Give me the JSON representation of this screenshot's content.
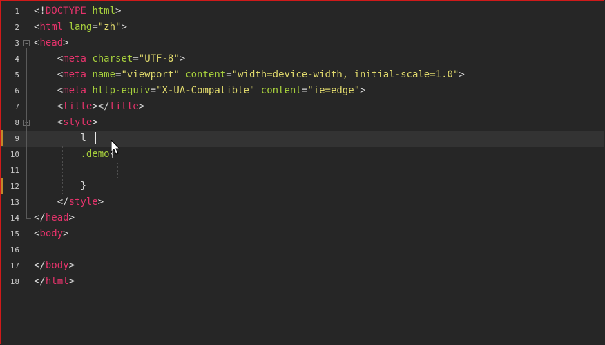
{
  "editor": {
    "colors": {
      "background": "#262626",
      "current_line": "#333333",
      "border": "#d01a1a",
      "tag": "#e5336b",
      "attr": "#a6cf3c",
      "string": "#dfd86c",
      "punct": "#d8d8d8",
      "line_number": "#c9c9c9"
    },
    "current_line_number": "9",
    "lines": [
      {
        "num": "1",
        "indent": "",
        "tokens": [
          [
            "p",
            "<!"
          ],
          [
            "t",
            "DOCTYPE"
          ],
          [
            "p",
            " "
          ],
          [
            "a",
            "html"
          ],
          [
            "p",
            ">"
          ]
        ]
      },
      {
        "num": "2",
        "indent": "",
        "tokens": [
          [
            "p",
            "<"
          ],
          [
            "t",
            "html"
          ],
          [
            "p",
            " "
          ],
          [
            "a",
            "lang"
          ],
          [
            "p",
            "="
          ],
          [
            "s",
            "\"zh\""
          ],
          [
            "p",
            ">"
          ]
        ]
      },
      {
        "num": "3",
        "indent": "",
        "fold": "open",
        "tokens": [
          [
            "p",
            "<"
          ],
          [
            "t",
            "head"
          ],
          [
            "p",
            ">"
          ]
        ]
      },
      {
        "num": "4",
        "indent": "    ",
        "tokens": [
          [
            "p",
            "<"
          ],
          [
            "t",
            "meta"
          ],
          [
            "p",
            " "
          ],
          [
            "a",
            "charset"
          ],
          [
            "p",
            "="
          ],
          [
            "s",
            "\"UTF-8\""
          ],
          [
            "p",
            ">"
          ]
        ]
      },
      {
        "num": "5",
        "indent": "    ",
        "tokens": [
          [
            "p",
            "<"
          ],
          [
            "t",
            "meta"
          ],
          [
            "p",
            " "
          ],
          [
            "a",
            "name"
          ],
          [
            "p",
            "="
          ],
          [
            "s",
            "\"viewport\""
          ],
          [
            "p",
            " "
          ],
          [
            "a",
            "content"
          ],
          [
            "p",
            "="
          ],
          [
            "s",
            "\"width=device-width, initial-scale=1.0\""
          ],
          [
            "p",
            ">"
          ]
        ]
      },
      {
        "num": "6",
        "indent": "    ",
        "tokens": [
          [
            "p",
            "<"
          ],
          [
            "t",
            "meta"
          ],
          [
            "p",
            " "
          ],
          [
            "a",
            "http-equiv"
          ],
          [
            "p",
            "="
          ],
          [
            "s",
            "\"X-UA-Compatible\""
          ],
          [
            "p",
            " "
          ],
          [
            "a",
            "content"
          ],
          [
            "p",
            "="
          ],
          [
            "s",
            "\"ie=edge\""
          ],
          [
            "p",
            ">"
          ]
        ]
      },
      {
        "num": "7",
        "indent": "    ",
        "tokens": [
          [
            "p",
            "<"
          ],
          [
            "t",
            "title"
          ],
          [
            "p",
            "></"
          ],
          [
            "t",
            "title"
          ],
          [
            "p",
            ">"
          ]
        ]
      },
      {
        "num": "8",
        "indent": "    ",
        "fold": "open",
        "tokens": [
          [
            "p",
            "<"
          ],
          [
            "t",
            "style"
          ],
          [
            "p",
            ">"
          ]
        ]
      },
      {
        "num": "9",
        "indent": "        ",
        "tokens": [
          [
            "p",
            "l"
          ]
        ]
      },
      {
        "num": "10",
        "indent": "        ",
        "tokens": [
          [
            "c",
            ".demo"
          ],
          [
            "p",
            "{"
          ]
        ]
      },
      {
        "num": "11",
        "indent": "",
        "tokens": []
      },
      {
        "num": "12",
        "indent": "        ",
        "tokens": [
          [
            "p",
            "}"
          ]
        ]
      },
      {
        "num": "13",
        "indent": "    ",
        "fold": "end",
        "tokens": [
          [
            "p",
            "</"
          ],
          [
            "t",
            "style"
          ],
          [
            "p",
            ">"
          ]
        ]
      },
      {
        "num": "14",
        "indent": "",
        "fold": "end",
        "tokens": [
          [
            "p",
            "</"
          ],
          [
            "t",
            "head"
          ],
          [
            "p",
            ">"
          ]
        ]
      },
      {
        "num": "15",
        "indent": "",
        "tokens": [
          [
            "p",
            "<"
          ],
          [
            "t",
            "body"
          ],
          [
            "p",
            ">"
          ]
        ]
      },
      {
        "num": "16",
        "indent": "",
        "tokens": []
      },
      {
        "num": "17",
        "indent": "",
        "tokens": [
          [
            "p",
            "</"
          ],
          [
            "t",
            "body"
          ],
          [
            "p",
            ">"
          ]
        ]
      },
      {
        "num": "18",
        "indent": "",
        "tokens": [
          [
            "p",
            "</"
          ],
          [
            "t",
            "html"
          ],
          [
            "p",
            ">"
          ]
        ]
      }
    ]
  }
}
